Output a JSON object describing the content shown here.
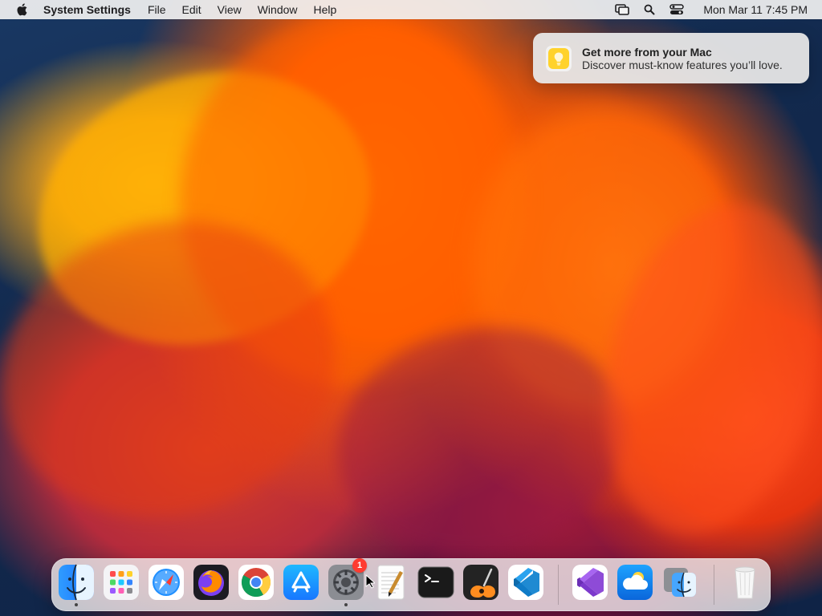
{
  "menu_bar": {
    "app_name": "System Settings",
    "items": [
      {
        "label": "File"
      },
      {
        "label": "Edit"
      },
      {
        "label": "View"
      },
      {
        "label": "Window"
      },
      {
        "label": "Help"
      }
    ],
    "status_icons": [
      "screen-mirroring-icon",
      "spotlight-search-icon",
      "control-center-icon"
    ],
    "clock": "Mon Mar 11  7:45 PM"
  },
  "notification": {
    "title": "Get more from your Mac",
    "body": "Discover must-know features you’ll love.",
    "icon": "tips-lightbulb-icon"
  },
  "dock": {
    "apps": [
      {
        "name": "Finder",
        "icon": "finder-icon",
        "running": true
      },
      {
        "name": "Launchpad",
        "icon": "launchpad-icon",
        "running": false
      },
      {
        "name": "Safari",
        "icon": "safari-icon",
        "running": false
      },
      {
        "name": "Firefox",
        "icon": "firefox-icon",
        "running": false
      },
      {
        "name": "Google Chrome",
        "icon": "chrome-icon",
        "running": false
      },
      {
        "name": "App Store",
        "icon": "app-store-icon",
        "running": false
      },
      {
        "name": "System Settings",
        "icon": "system-settings-icon",
        "running": true,
        "badge": "1"
      },
      {
        "name": "TextEdit",
        "icon": "textedit-icon",
        "running": false
      },
      {
        "name": "Terminal",
        "icon": "terminal-icon",
        "running": false
      },
      {
        "name": "GarageBand",
        "icon": "garageband-icon",
        "running": false
      },
      {
        "name": "Visual Studio Code",
        "icon": "vscode-icon",
        "running": false
      },
      {
        "name": "Visual Studio",
        "icon": "visual-studio-icon",
        "running": false
      },
      {
        "name": "Weather",
        "icon": "weather-icon",
        "running": false
      },
      {
        "name": "Migration Assistant",
        "icon": "migration-assistant-icon",
        "running": false
      },
      {
        "name": "Trash",
        "icon": "trash-icon",
        "running": false
      }
    ]
  }
}
